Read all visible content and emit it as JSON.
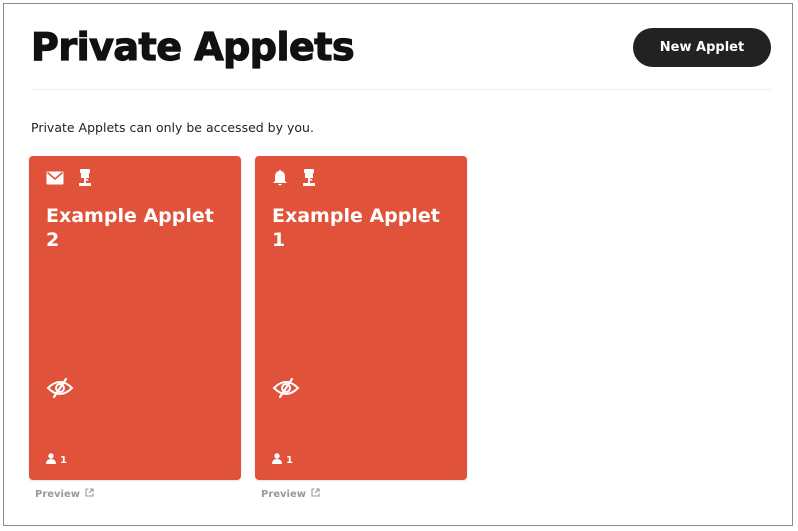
{
  "header": {
    "title": "Private Applets",
    "new_applet_label": "New Applet"
  },
  "description": "Private Applets can only be accessed by you.",
  "applets": [
    {
      "title": "Example Applet 2",
      "trigger_icon": "email-icon",
      "action_icon": "desk-lamp-icon",
      "status_icon": "eye-off-icon",
      "users": "1",
      "preview_label": "Preview",
      "color": "#e0533a"
    },
    {
      "title": "Example Applet 1",
      "trigger_icon": "bell-icon",
      "action_icon": "desk-lamp-icon",
      "status_icon": "eye-off-icon",
      "users": "1",
      "preview_label": "Preview",
      "color": "#e0533a"
    }
  ],
  "colors": {
    "accent": "#e0533a",
    "button_bg": "#222222",
    "link_muted": "#999999"
  }
}
